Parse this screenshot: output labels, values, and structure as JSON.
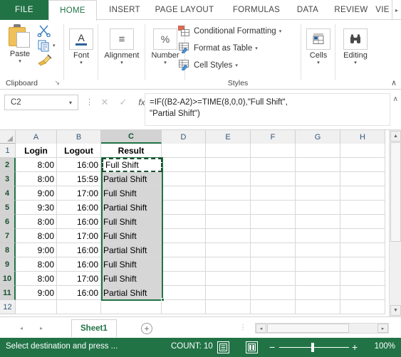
{
  "ribbon": {
    "tabs": [
      {
        "label": "FILE",
        "active": false,
        "file": true
      },
      {
        "label": "HOME",
        "active": true
      },
      {
        "label": "INSERT",
        "active": false
      },
      {
        "label": "PAGE LAYOUT",
        "active": false
      },
      {
        "label": "FORMULAS",
        "active": false
      },
      {
        "label": "DATA",
        "active": false
      },
      {
        "label": "REVIEW",
        "active": false
      },
      {
        "label": "VIE",
        "active": false
      }
    ],
    "overflow_caret": "▸",
    "groups": {
      "clipboard": {
        "label": "Clipboard",
        "paste_label": "Paste",
        "caret": "▾",
        "dialog_launcher": "↘",
        "cut_icon": "scissors-icon",
        "copy_icon": "copy-icon",
        "format_painter_icon": "format-painter-icon",
        "copy_caret": "▾"
      },
      "font": {
        "label": "Font",
        "icon_glyph": "A",
        "caret": "▾"
      },
      "alignment": {
        "label": "Alignment",
        "icon_glyph": "≡",
        "caret": "▾"
      },
      "number": {
        "label": "Number",
        "icon_glyph": "%",
        "caret": "▾"
      },
      "styles": {
        "label": "Styles",
        "items": [
          {
            "label": "Conditional Formatting",
            "caret": "▾"
          },
          {
            "label": "Format as Table",
            "caret": "▾"
          },
          {
            "label": "Cell Styles",
            "caret": "▾"
          }
        ]
      },
      "cells": {
        "label": "Cells",
        "caret": "▾"
      },
      "editing": {
        "label": "Editing",
        "caret": "▾"
      },
      "collapse_caret": "∧"
    }
  },
  "formula_bar": {
    "name_box_value": "C2",
    "name_box_caret": "▾",
    "dots": "⋮",
    "cancel_glyph": "✕",
    "enter_glyph": "✓",
    "fx_glyph": "fx",
    "formula": "=IF((B2-A2)>=TIME(8,0,0),\"Full Shift\",\n\"Partial Shift\")",
    "expand_caret": "∧"
  },
  "grid": {
    "columns": [
      "A",
      "B",
      "C",
      "D",
      "E",
      "F",
      "G",
      "H"
    ],
    "selected_column": "C",
    "rows": [
      "1",
      "2",
      "3",
      "4",
      "5",
      "6",
      "7",
      "8",
      "9",
      "10",
      "11",
      "12"
    ],
    "selected_rows": [
      "2",
      "3",
      "4",
      "5",
      "6",
      "7",
      "8",
      "9",
      "10",
      "11"
    ],
    "headers": {
      "a": "Login",
      "b": "Logout",
      "c": "Result"
    },
    "data": [
      {
        "row": "2",
        "login": "8:00",
        "logout": "16:00",
        "result": "Full Shift"
      },
      {
        "row": "3",
        "login": "8:00",
        "logout": "15:59",
        "result": "Partial Shift"
      },
      {
        "row": "4",
        "login": "9:00",
        "logout": "17:00",
        "result": "Full Shift"
      },
      {
        "row": "5",
        "login": "9:30",
        "logout": "16:00",
        "result": "Partial Shift"
      },
      {
        "row": "6",
        "login": "8:00",
        "logout": "16:00",
        "result": "Full Shift"
      },
      {
        "row": "7",
        "login": "8:00",
        "logout": "17:00",
        "result": "Full Shift"
      },
      {
        "row": "8",
        "login": "9:00",
        "logout": "16:00",
        "result": "Partial Shift"
      },
      {
        "row": "9",
        "login": "8:00",
        "logout": "16:00",
        "result": "Full Shift"
      },
      {
        "row": "10",
        "login": "8:00",
        "logout": "17:00",
        "result": "Full Shift"
      },
      {
        "row": "11",
        "login": "9:00",
        "logout": "16:00",
        "result": "Partial Shift"
      }
    ],
    "copied_cell": {
      "ref": "C2",
      "text": "Full Shift"
    },
    "scroll_up_arrow": "▲",
    "scroll_down_arrow": "▼"
  },
  "sheet_tabs": {
    "prev_arrow": "◂",
    "next_arrow": "▸",
    "tabs": [
      {
        "label": "Sheet1",
        "active": true
      }
    ],
    "add_sheet_glyph": "+",
    "hsb_dots": "⋮",
    "hsb_left": "◂",
    "hsb_right": "▸"
  },
  "status_bar": {
    "message": "Select destination and press ...",
    "count": "COUNT: 10",
    "view_normal_icon": "normal-view-icon",
    "view_pagelayout_icon": "page-layout-view-icon",
    "view_pagebreak_icon": "page-break-view-icon",
    "zoom_out": "−",
    "zoom_in": "+",
    "zoom_level": "100%"
  },
  "colors": {
    "excel_green": "#217346",
    "selection_green": "#1b5132",
    "header_blue": "#33587a"
  }
}
